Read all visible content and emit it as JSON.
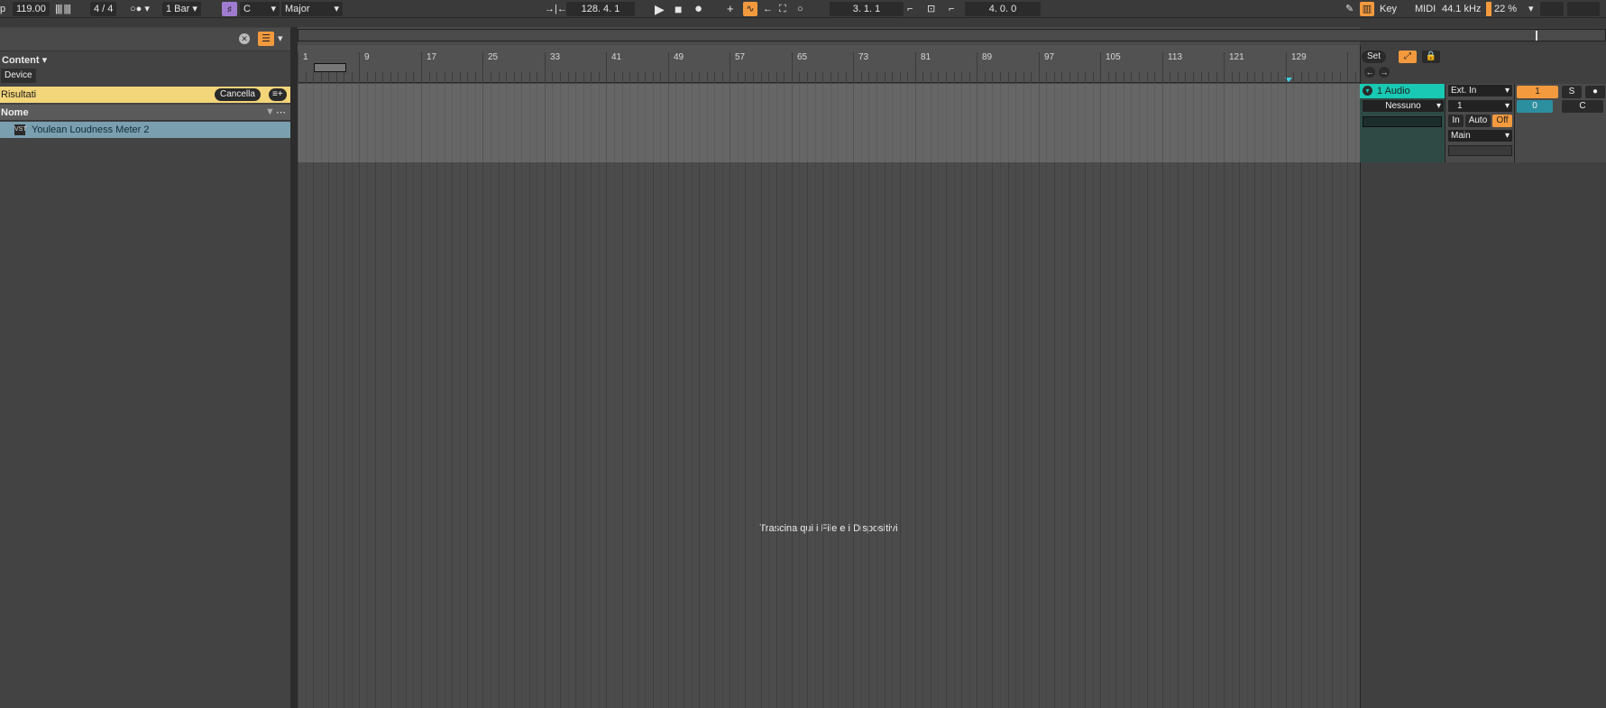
{
  "transport": {
    "tap_label": "p",
    "tempo": "119.00",
    "time_sig": "4 / 4",
    "quantize": "1 Bar",
    "key_root": "C",
    "scale": "Major",
    "arrangement_position": "128.  4.  1",
    "loop_start": "3.  1.  1",
    "loop_length": "4.  0.  0",
    "key_label": "Key",
    "midi_label": "MIDI",
    "sample_rate": "44.1 kHz",
    "cpu": "22 %"
  },
  "browser": {
    "content_label": "Content ▾",
    "device_label": "Device",
    "results_label": "Risultati",
    "cancel_label": "Cancella",
    "column_name": "Nome",
    "items": [
      {
        "label": "Youlean Loudness Meter 2"
      }
    ]
  },
  "arrangement": {
    "ruler": [
      "1",
      "9",
      "17",
      "25",
      "33",
      "41",
      "49",
      "57",
      "65",
      "73",
      "81",
      "89",
      "97",
      "105",
      "113",
      "121",
      "129"
    ],
    "drop_hint": "Trascina qui i File e i Dispositivi"
  },
  "track": {
    "name": "1 Audio",
    "monitor_none": "Nessuno",
    "input_type": "Ext. In",
    "input_channel": "1",
    "mon_in": "In",
    "mon_auto": "Auto",
    "mon_off": "Off",
    "output": "Main",
    "track_number": "1",
    "solo": "S",
    "volume": "0",
    "pan": "C",
    "set_label": "Set"
  },
  "colors": {
    "accent": "#f39a3e",
    "track": "#19c9b3",
    "results": "#f3d57a"
  }
}
